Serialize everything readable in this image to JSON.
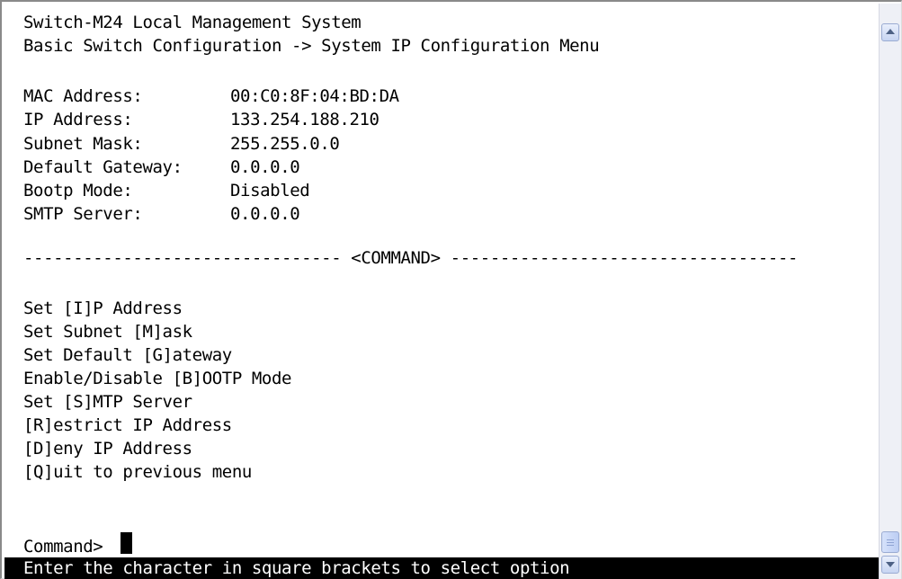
{
  "header": {
    "title": "Switch-M24 Local Management System",
    "breadcrumb": "Basic Switch Configuration -> System IP Configuration Menu"
  },
  "system_info": [
    {
      "label": "MAC Address:",
      "value": "00:C0:8F:04:BD:DA"
    },
    {
      "label": "IP Address:",
      "value": "133.254.188.210"
    },
    {
      "label": "Subnet Mask:",
      "value": "255.255.0.0"
    },
    {
      "label": "Default Gateway:",
      "value": "0.0.0.0"
    },
    {
      "label": "Bootp Mode:",
      "value": "Disabled"
    },
    {
      "label": "SMTP Server:",
      "value": "0.0.0.0"
    }
  ],
  "command_separator": "-------------------------------- <COMMAND> -----------------------------------",
  "commands": [
    "Set [I]P Address",
    "Set Subnet [M]ask",
    "Set Default [G]ateway",
    "Enable/Disable [B]OOTP Mode",
    "Set [S]MTP Server",
    "[R]estrict IP Address",
    "[D]eny IP Address",
    "[Q]uit to previous menu"
  ],
  "prompt": {
    "label": "Command>",
    "value": ""
  },
  "status_bar": "Enter the character in square brackets to select option",
  "icons": {
    "scroll_up": "arrow-up-icon",
    "scroll_down": "arrow-down-icon",
    "scroll_thumb": "grip-icon"
  }
}
